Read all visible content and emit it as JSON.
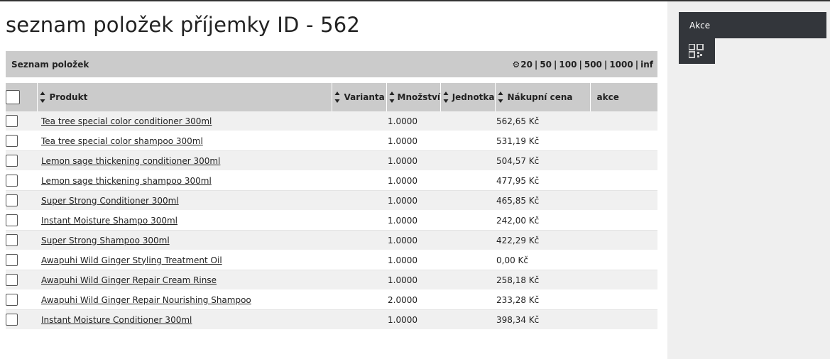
{
  "page": {
    "title": "seznam položek příjemky ID - 562"
  },
  "panel": {
    "title": "Seznam položek",
    "pager_sizes": [
      "20",
      "50",
      "100",
      "500",
      "1000",
      "inf"
    ]
  },
  "table": {
    "headers": {
      "product": "Produkt",
      "variant": "Varianta",
      "quantity": "Množství",
      "unit": "Jednotka",
      "price": "Nákupní cena",
      "actions": "akce"
    },
    "rows": [
      {
        "product": "Tea tree special color conditioner 300ml",
        "variant": "",
        "quantity": "1.0000",
        "unit": "",
        "price": "562,65 Kč",
        "actions": ""
      },
      {
        "product": "Tea tree special color shampoo 300ml",
        "variant": "",
        "quantity": "1.0000",
        "unit": "",
        "price": "531,19 Kč",
        "actions": ""
      },
      {
        "product": "Lemon sage thickening conditioner 300ml",
        "variant": "",
        "quantity": "1.0000",
        "unit": "",
        "price": "504,57 Kč",
        "actions": ""
      },
      {
        "product": "Lemon sage thickening shampoo 300ml",
        "variant": "",
        "quantity": "1.0000",
        "unit": "",
        "price": "477,95 Kč",
        "actions": ""
      },
      {
        "product": "Super Strong Conditioner 300ml",
        "variant": "",
        "quantity": "1.0000",
        "unit": "",
        "price": "465,85 Kč",
        "actions": ""
      },
      {
        "product": "Instant Moisture Shampo 300ml",
        "variant": "",
        "quantity": "1.0000",
        "unit": "",
        "price": "242,00 Kč",
        "actions": ""
      },
      {
        "product": "Super Strong Shampoo 300ml",
        "variant": "",
        "quantity": "1.0000",
        "unit": "",
        "price": "422,29 Kč",
        "actions": ""
      },
      {
        "product": "Awapuhi Wild Ginger Styling Treatment Oil",
        "variant": "",
        "quantity": "1.0000",
        "unit": "",
        "price": "0,00 Kč",
        "actions": ""
      },
      {
        "product": "Awapuhi Wild Ginger Repair Cream Rinse",
        "variant": "",
        "quantity": "1.0000",
        "unit": "",
        "price": "258,18 Kč",
        "actions": ""
      },
      {
        "product": "Awapuhi Wild Ginger Repair Nourishing Shampoo",
        "variant": "",
        "quantity": "2.0000",
        "unit": "",
        "price": "233,28 Kč",
        "actions": ""
      },
      {
        "product": "Instant Moisture Conditioner 300ml",
        "variant": "",
        "quantity": "1.0000",
        "unit": "",
        "price": "398,34 Kč",
        "actions": ""
      }
    ]
  },
  "sidebar": {
    "actions_title": "Akce",
    "qr_icon": "qr-code-icon"
  },
  "colors": {
    "header_gray": "#cbcbcb",
    "sidebar_bg": "#efefef",
    "dark_button": "#33363b"
  }
}
